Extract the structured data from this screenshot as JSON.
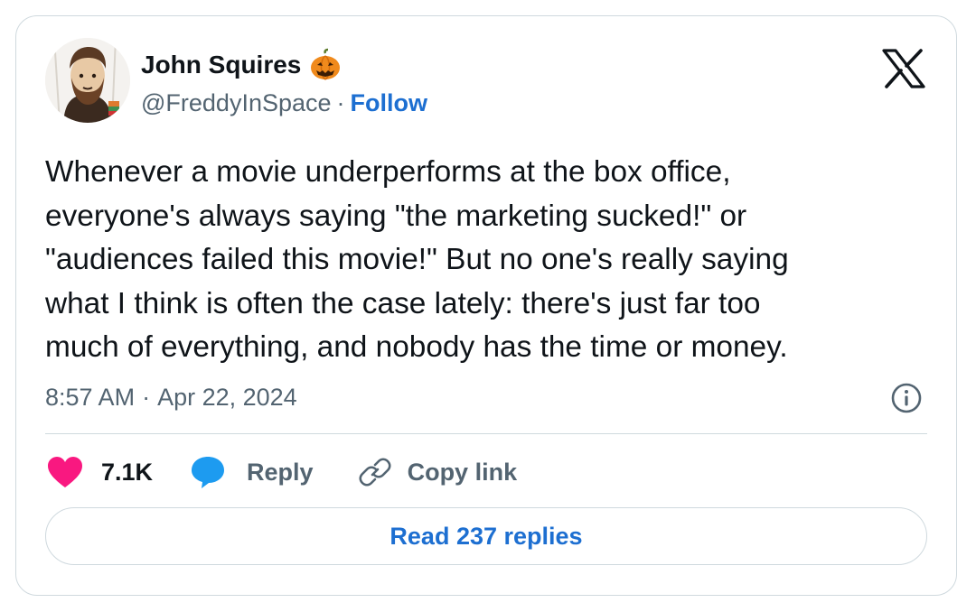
{
  "author": {
    "name": "John Squires",
    "name_emoji": "pumpkin-icon",
    "handle": "@FreddyInSpace",
    "separator": "·",
    "follow_label": "Follow"
  },
  "tweet": {
    "text": "Whenever a movie underperforms at the box office,\neveryone's always saying \"the marketing sucked!\" or\n\"audiences failed this movie!\" But no one's really saying\nwhat I think is often the case lately: there's just far too\nmuch of everything, and nobody has the time or money.",
    "time": "8:57 AM",
    "separator": "·",
    "date": "Apr 22, 2024"
  },
  "actions": {
    "like_count": "7.1K",
    "reply_label": "Reply",
    "copy_link_label": "Copy link"
  },
  "read_replies_label": "Read 237 replies",
  "icons": {
    "brand": "x-logo-icon",
    "info": "info-icon",
    "like": "heart-icon",
    "reply": "speech-bubble-icon",
    "copy": "link-icon"
  },
  "colors": {
    "text": "#0f1419",
    "secondary": "#536471",
    "link": "#1d6fd1",
    "heart": "#f91880",
    "reply_bubble": "#1d9bf0",
    "border": "#cfd9de"
  }
}
